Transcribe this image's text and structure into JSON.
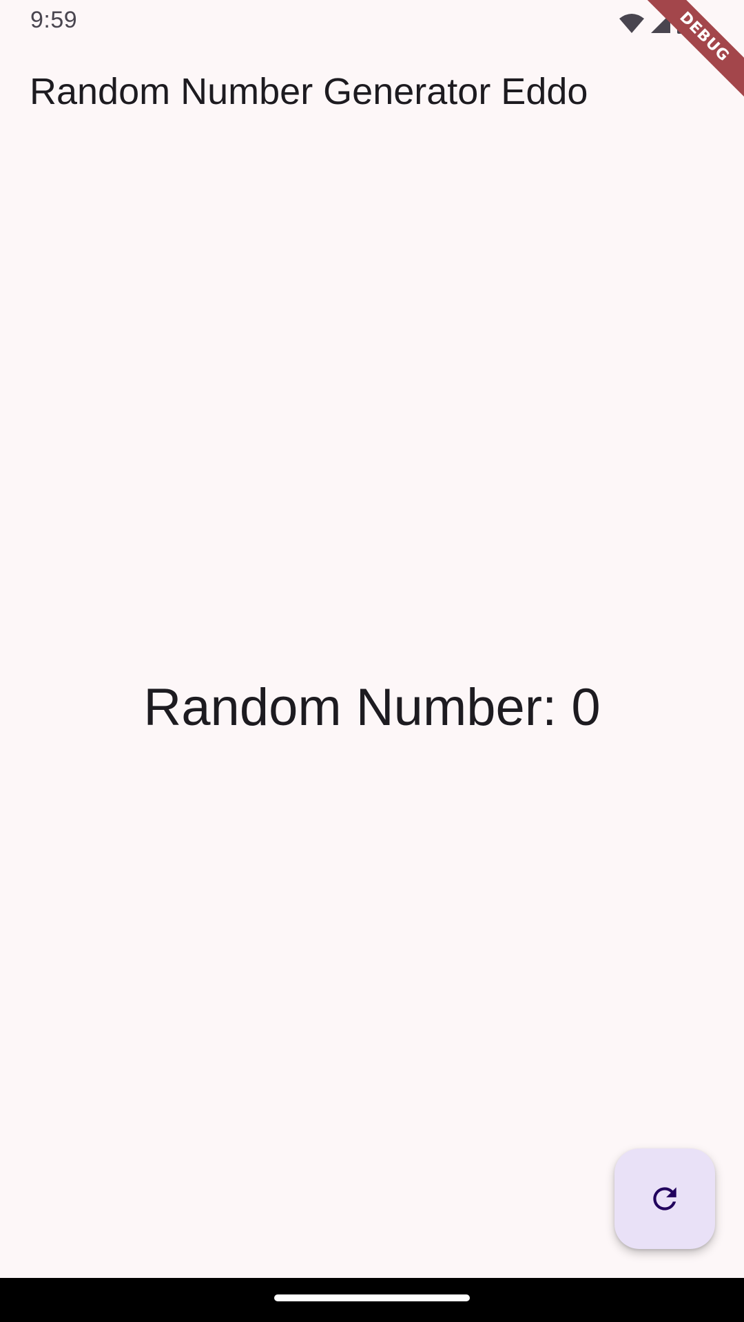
{
  "status_bar": {
    "time": "9:59",
    "icons": [
      "wifi-icon",
      "signal-icon",
      "battery-icon"
    ]
  },
  "debug_banner": {
    "label": "DEBUG"
  },
  "app_bar": {
    "title": "Random Number Generator Eddo"
  },
  "main": {
    "random_text": "Random Number: 0"
  },
  "fab": {
    "icon": "refresh-icon",
    "background_color": "#e9e1f7",
    "icon_color": "#21005d"
  },
  "colors": {
    "background": "#fdf7f8",
    "text": "#1d1b20",
    "banner": "#a3464b"
  }
}
